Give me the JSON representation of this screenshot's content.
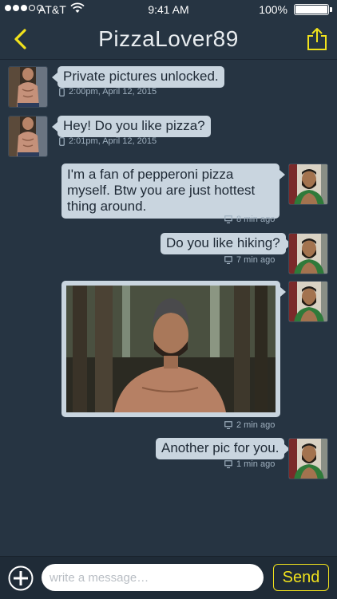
{
  "status_bar": {
    "carrier": "AT&T",
    "time": "9:41 AM",
    "battery": "100%",
    "signal_bars": 3
  },
  "nav": {
    "title": "PizzaLover89",
    "back_icon": "chevron-left-icon",
    "share_icon": "share-icon"
  },
  "accent_color": "#f1e21c",
  "messages": [
    {
      "side": "left",
      "text": "Private pictures unlocked.",
      "meta": "2:00pm, April 12, 2015",
      "meta_icon": "phone-icon"
    },
    {
      "side": "left",
      "text": "Hey! Do you like pizza?",
      "meta": "2:01pm, April 12, 2015",
      "meta_icon": "phone-icon"
    },
    {
      "side": "right",
      "text": "I'm a fan of pepperoni pizza myself. Btw you are just hottest thing around.",
      "meta": "8 min ago",
      "meta_icon": "desktop-icon"
    },
    {
      "side": "right",
      "text": "Do you like hiking?",
      "meta": "7 min ago",
      "meta_icon": "desktop-icon"
    },
    {
      "side": "right",
      "type": "photo",
      "meta": "2 min ago",
      "meta_icon": "desktop-icon"
    },
    {
      "side": "right",
      "text": "Another pic for you.",
      "meta": "1 min ago",
      "meta_icon": "desktop-icon"
    }
  ],
  "composer": {
    "placeholder": "write a message…",
    "value": "",
    "send_label": "Send",
    "attach_icon": "plus-circle-icon"
  }
}
